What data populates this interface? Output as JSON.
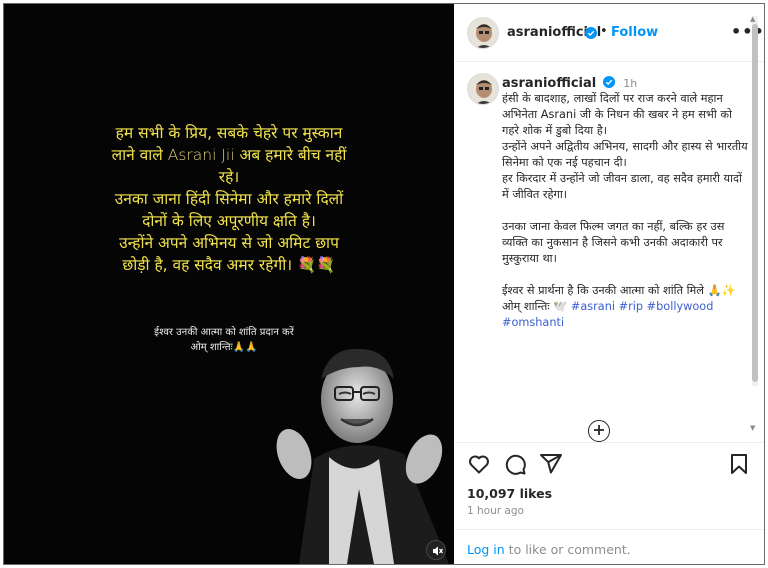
{
  "post": {
    "poster_line1": "हम सभी के प्रिय, सबके चेहरे पर मुस्कान",
    "poster_line2a": "लाने वाले ",
    "poster_name": "Asrani Jii",
    "poster_line2b": " अब हमारे बीच नहीं",
    "poster_line3": "रहे।",
    "poster_line4": "उनका जाना हिंदी सिनेमा और हमारे दिलों",
    "poster_line5": "दोनों के लिए अपूरणीय क्षति है।",
    "poster_line6": "उन्होंने अपने अभिनय से जो अमिट छाप",
    "poster_line7": "छोड़ी है, वह सदैव अमर रहेगी। 💐💐",
    "poster_sub1": "ईश्वर उनकी आत्मा को शांति प्रदान करें",
    "poster_sub2": "ओम् शान्तिः🙏🙏"
  },
  "header": {
    "username": "asraniofficial",
    "dot": "•",
    "follow_label": "Follow",
    "more_label": "•••"
  },
  "caption": {
    "username": "asraniofficial",
    "time": "1h",
    "body": "हंसी के बादशाह, लाखों दिलों पर राज करने वाले महान अभिनेता Asrani जी के निधन की खबर ने हम सभी को गहरे शोक में डुबो दिया है।\nउन्होंने अपने अद्वितीय अभिनय, सादगी और हास्य से भारतीय सिनेमा को एक नई पहचान दी।\nहर किरदार में उन्होंने जो जीवन डाला, वह सदैव हमारी यादों में जीवित रहेगा।\n\nउनका जाना केवल फिल्म जगत का नहीं, बल्कि हर उस व्यक्ति का नुकसान है जिसने कभी उनकी अदाकारी पर मुस्कुराया था।\n\nईश्वर से प्रार्थना है कि उनकी आत्मा को शांति मिले 🙏✨\nओम् शान्तिः 🕊️ ",
    "tags": [
      "#asrani",
      "#rip",
      "#bollywood",
      "#omshanti"
    ]
  },
  "stats": {
    "likes": "10,097 likes",
    "ago": "1 hour ago"
  },
  "login": {
    "link": "Log in",
    "rest": " to like or comment."
  },
  "colors": {
    "accent": "#0095f6",
    "poster_text": "#f2e34c",
    "hashtag": "#3b5fcf"
  },
  "icons": [
    "heart-icon",
    "comment-icon",
    "share-icon",
    "bookmark-icon",
    "verified-icon",
    "add-circle-icon"
  ]
}
